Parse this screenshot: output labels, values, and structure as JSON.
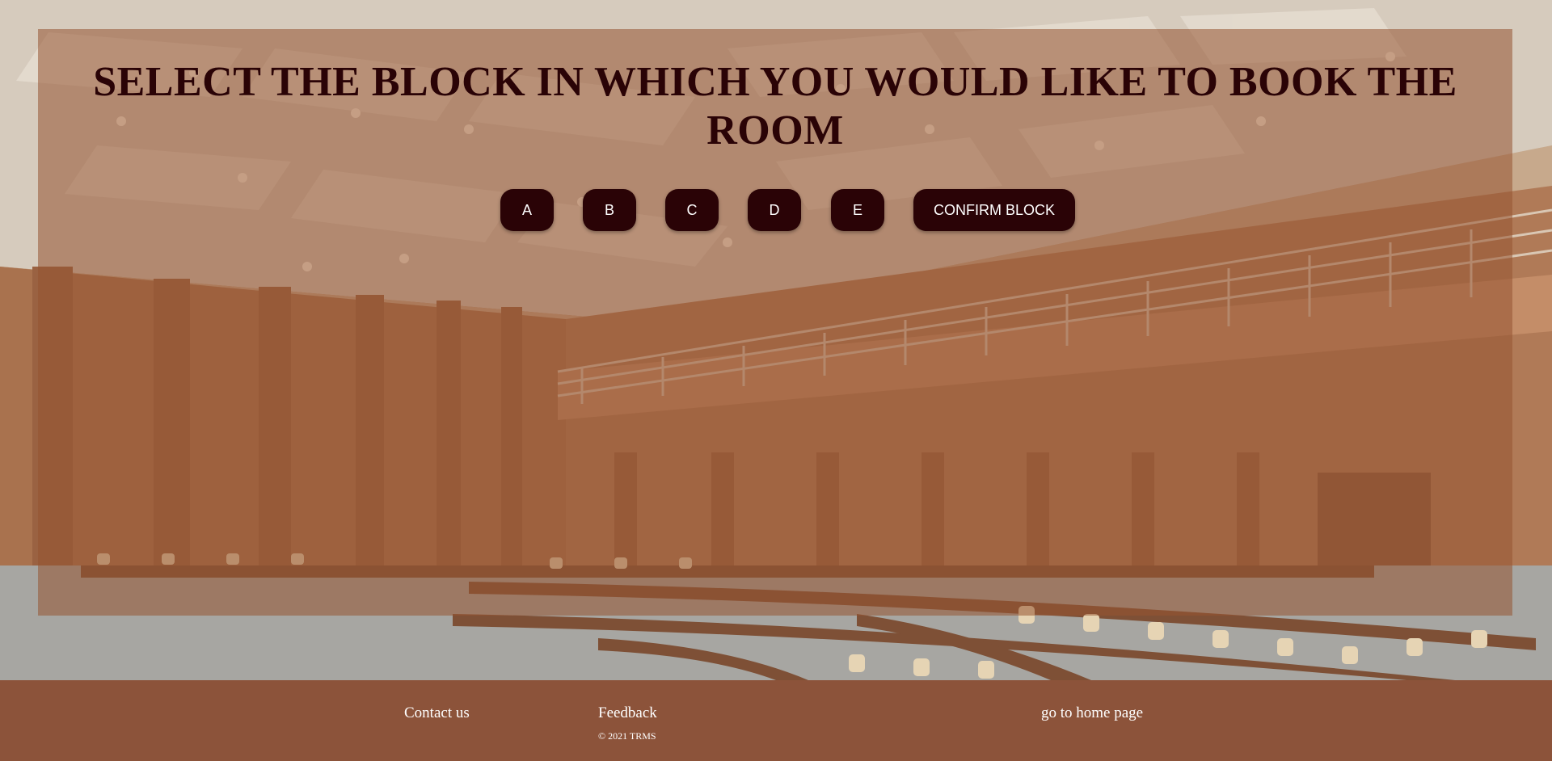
{
  "page": {
    "heading": "SELECT THE BLOCK IN WHICH YOU WOULD LIKE TO BOOK THE ROOM"
  },
  "blocks": {
    "a_label": "A",
    "b_label": "B",
    "c_label": "C",
    "d_label": "D",
    "e_label": "E",
    "confirm_label": "CONFIRM BLOCK"
  },
  "footer": {
    "contact_label": "Contact us",
    "feedback_label": "Feedback",
    "copyright": "© 2021 TRMS",
    "home_label": "go to home page"
  },
  "colors": {
    "button_bg": "#2a0306",
    "heading": "#2a0306",
    "footer_bg": "#8c533a",
    "overlay": "#965432"
  }
}
